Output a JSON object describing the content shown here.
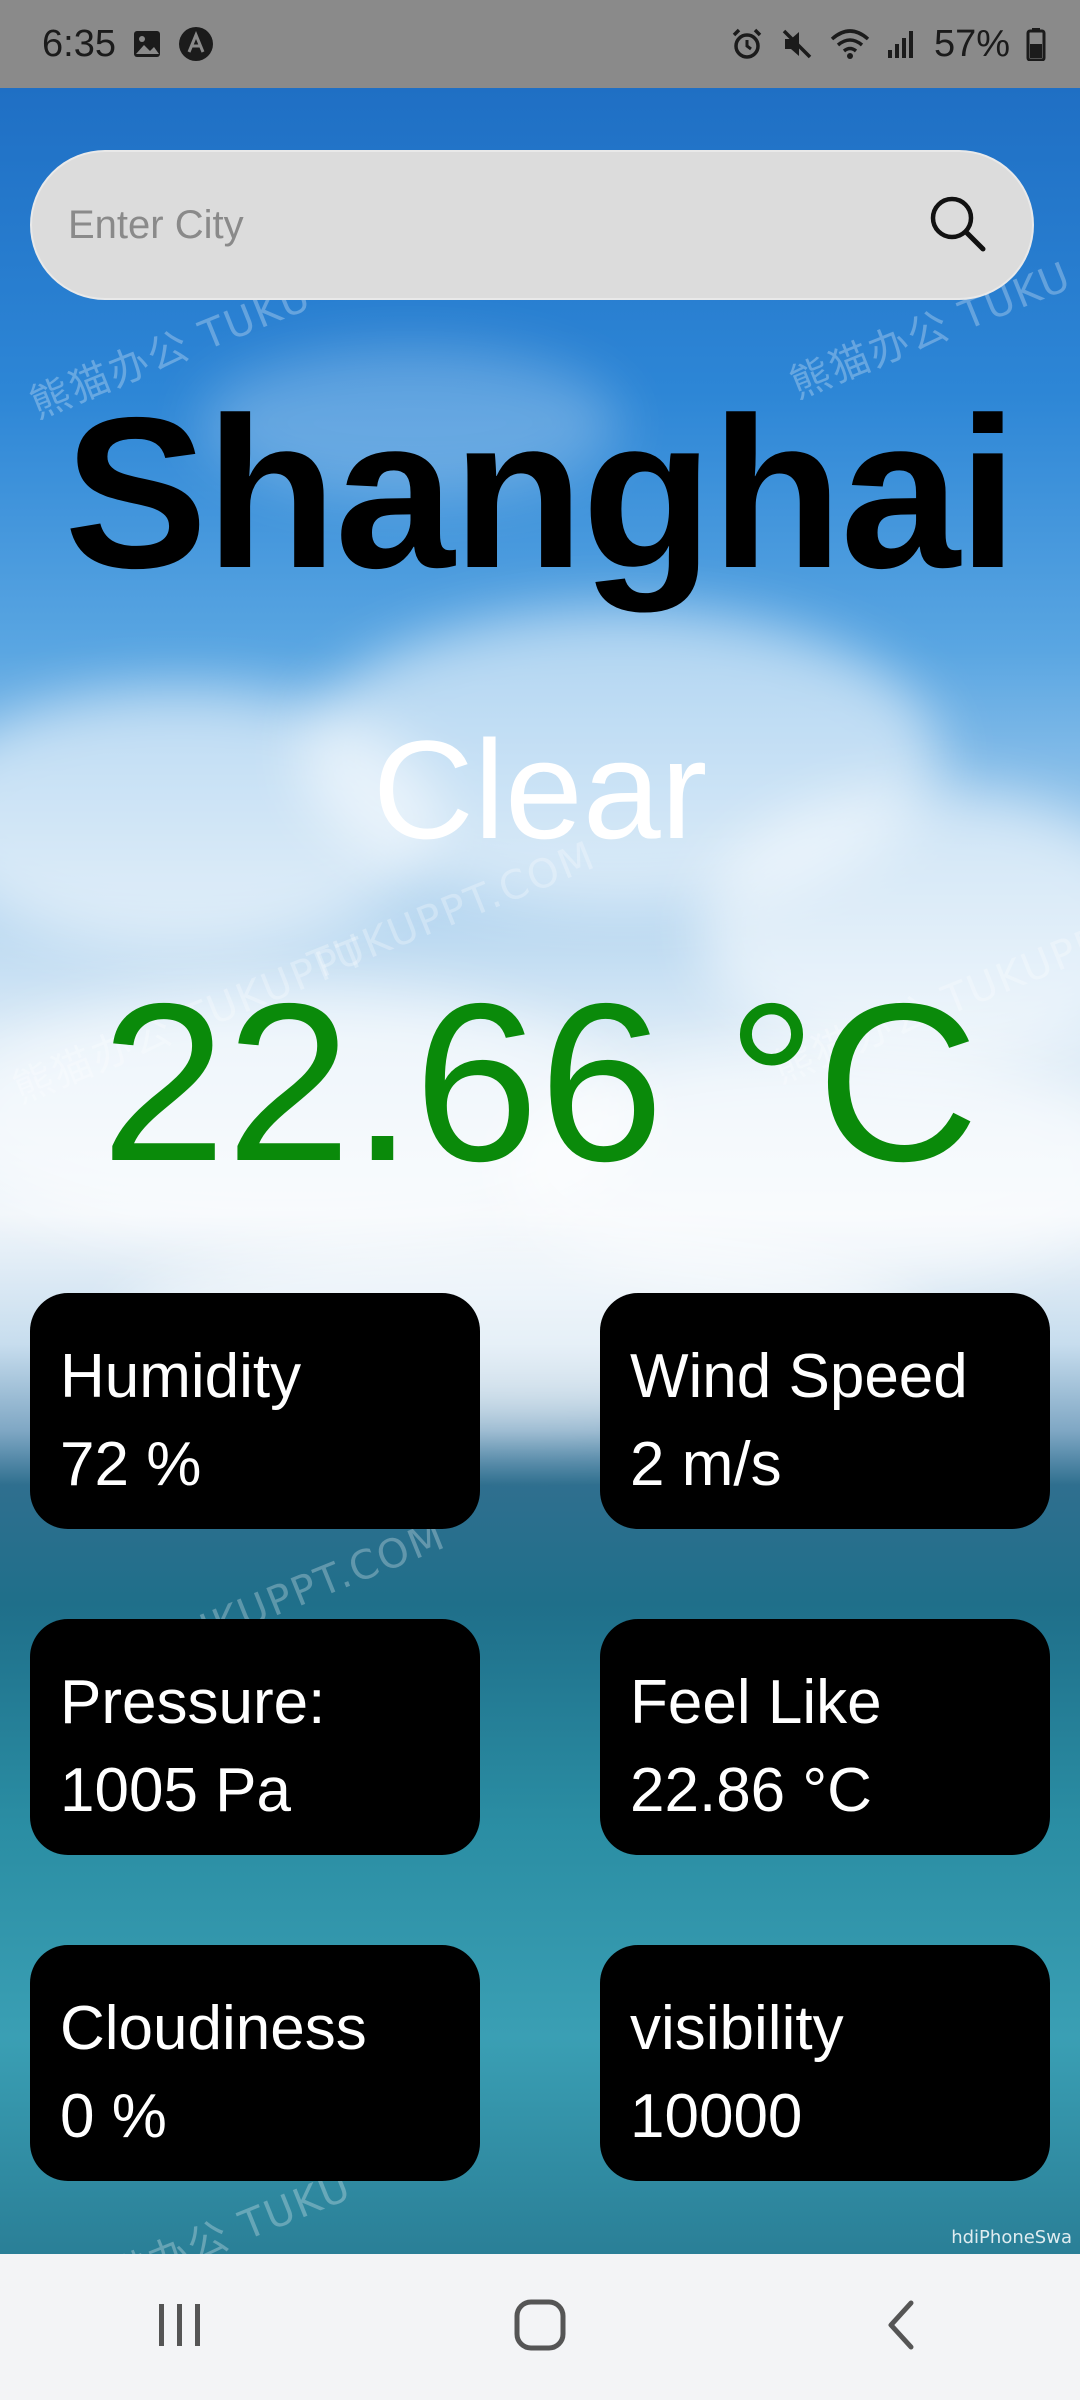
{
  "status_bar": {
    "time": "6:35",
    "battery": "57%",
    "left_icons": [
      "image-icon",
      "app-a-icon"
    ],
    "right_icons": [
      "alarm-icon",
      "mute-icon",
      "wifi-icon",
      "signal-icon",
      "battery-icon"
    ]
  },
  "search": {
    "placeholder": "Enter City",
    "value": "",
    "icon": "search-icon"
  },
  "weather": {
    "city": "Shanghai",
    "condition": "Clear",
    "temperature": "22.66 °C"
  },
  "cards": [
    {
      "label": "Humidity",
      "value": "72 %"
    },
    {
      "label": "Wind Speed",
      "value": "2 m/s"
    },
    {
      "label": "Pressure:",
      "value": "1005 Pa"
    },
    {
      "label": "Feel Like",
      "value": "22.86 °C"
    },
    {
      "label": "Cloudiness",
      "value": "0 %"
    },
    {
      "label": "visibility",
      "value": "10000"
    }
  ],
  "background": {
    "watermarks": [
      "熊猫办公 TUKU",
      "熊猫办公 TUKU",
      "TUKUPPT.COM",
      "熊猫办公 TUKUPPT",
      "熊猫办公 TUKUPPT",
      "TUKUPPT.COM",
      "熊猫办公 TUKU"
    ],
    "credit": "hdiPhoneSwa"
  },
  "nav_bar": {
    "buttons": [
      "recent-apps-icon",
      "home-icon",
      "back-icon"
    ]
  },
  "colors": {
    "temperature": "#0a8a0a",
    "city": "#000000",
    "condition": "#ffffff",
    "card_bg": "#000000"
  }
}
